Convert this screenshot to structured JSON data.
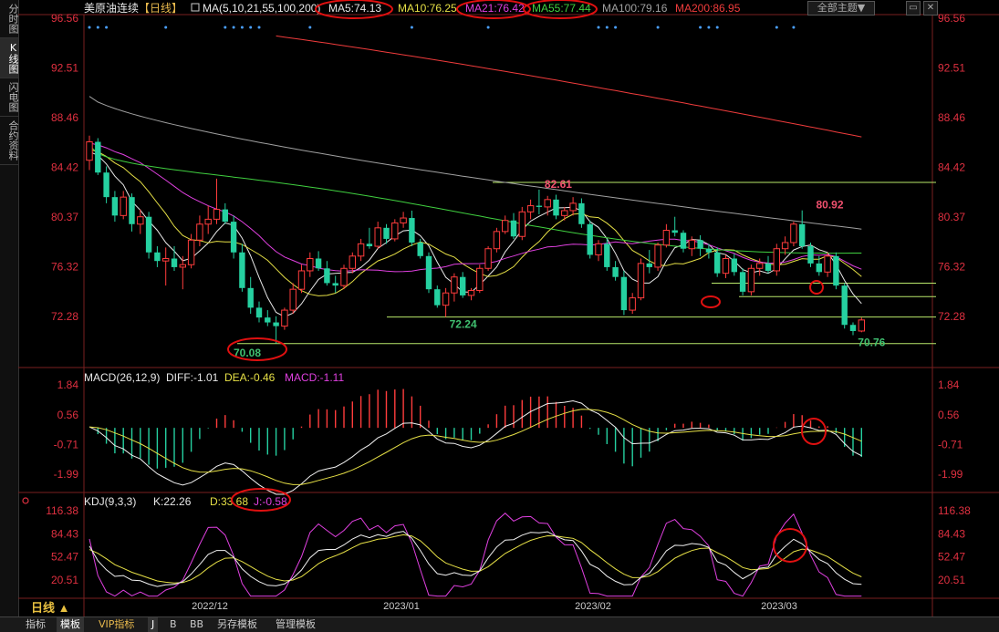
{
  "sidebar": {
    "tabs": [
      {
        "label": "分时图",
        "active": false
      },
      {
        "label": "K线图",
        "active": true
      },
      {
        "label": "闪电图",
        "active": false
      },
      {
        "label": "合约资料",
        "active": false
      }
    ]
  },
  "header": {
    "symbol": "美原油连续",
    "period_tag": "【日线】",
    "ma_params": "MA(5,10,21,55,100,200)",
    "ma_values": [
      {
        "label": "MA5:74.13",
        "color": "#e8e8e8"
      },
      {
        "label": "MA10:76.25",
        "color": "#e6e046"
      },
      {
        "label": "MA21:76.42",
        "color": "#e040e0"
      },
      {
        "label": "MA55:77.44",
        "color": "#40d040"
      },
      {
        "label": "MA100:79.16",
        "color": "#a0a0a0"
      },
      {
        "label": "MA200:86.95",
        "color": "#f03c3c"
      }
    ],
    "theme_button": "全部主题▼",
    "min_icon": "minimize-icon",
    "close_icon": "close-icon"
  },
  "price_axis": {
    "ticks": [
      "96.56",
      "92.51",
      "88.46",
      "84.42",
      "80.37",
      "76.32",
      "72.28"
    ]
  },
  "price_annotations": [
    {
      "text": "82.61",
      "color": "#f0506e"
    },
    {
      "text": "80.92",
      "color": "#f0506e"
    },
    {
      "text": "72.24",
      "color": "#40c070"
    },
    {
      "text": "70.08",
      "color": "#40c070"
    },
    {
      "text": "70.76",
      "color": "#40c070"
    }
  ],
  "macd": {
    "title": "MACD(26,12,9)",
    "diff": "DIFF:-1.01",
    "dea": "DEA:-0.46",
    "macd": "MACD:-1.11",
    "ticks": [
      "1.84",
      "0.56",
      "-0.71",
      "-1.99"
    ]
  },
  "kdj": {
    "title": "KDJ(9,3,3)",
    "k": "K:22.26",
    "d": "D:33.68",
    "j": "J:-0.58",
    "ticks": [
      "116.38",
      "84.43",
      "52.47",
      "20.51"
    ]
  },
  "period_button": "日线",
  "date_axis": [
    "2022/12",
    "2023/01",
    "2023/02",
    "2023/03"
  ],
  "bottom_tabs": [
    "指标",
    "模板",
    "VIP指标",
    "J",
    "B",
    "BB",
    "另存模板",
    "管理模板"
  ],
  "chart_data": [
    {
      "type": "candlestick",
      "name": "美原油连续 日线",
      "ylim": [
        68.5,
        96.56
      ],
      "ohlc": [
        [
          85.0,
          87.0,
          84.2,
          86.5
        ],
        [
          86.5,
          86.8,
          83.8,
          84.0
        ],
        [
          84.0,
          84.5,
          81.5,
          82.0
        ],
        [
          82.0,
          82.5,
          80.0,
          80.5
        ],
        [
          80.5,
          82.5,
          80.2,
          82.0
        ],
        [
          82.0,
          82.3,
          79.2,
          79.8
        ],
        [
          79.8,
          81.0,
          79.0,
          80.4
        ],
        [
          80.4,
          80.8,
          77.0,
          77.5
        ],
        [
          77.5,
          78.0,
          76.3,
          76.8
        ],
        [
          76.8,
          77.9,
          74.8,
          77.0
        ],
        [
          77.0,
          78.0,
          76.0,
          76.3
        ],
        [
          76.3,
          77.2,
          74.5,
          76.5
        ],
        [
          76.5,
          79.0,
          76.2,
          78.5
        ],
        [
          78.5,
          80.5,
          78.0,
          79.8
        ],
        [
          79.8,
          81.3,
          79.0,
          80.2
        ],
        [
          80.2,
          83.5,
          79.8,
          81.0
        ],
        [
          81.0,
          81.5,
          79.8,
          80.0
        ],
        [
          80.0,
          80.5,
          77.0,
          77.5
        ],
        [
          77.5,
          78.2,
          74.3,
          74.6
        ],
        [
          74.6,
          75.5,
          72.5,
          73.0
        ],
        [
          73.0,
          73.5,
          71.8,
          72.2
        ],
        [
          72.2,
          72.8,
          71.5,
          71.8
        ],
        [
          71.8,
          72.3,
          70.08,
          71.5
        ],
        [
          71.5,
          73.0,
          71.2,
          72.8
        ],
        [
          72.8,
          75.0,
          72.5,
          74.5
        ],
        [
          74.5,
          76.5,
          74.2,
          76.0
        ],
        [
          76.0,
          77.5,
          75.5,
          77.0
        ],
        [
          77.0,
          77.6,
          76.0,
          76.2
        ],
        [
          76.2,
          76.8,
          74.8,
          75.0
        ],
        [
          75.0,
          75.6,
          74.2,
          74.8
        ],
        [
          74.8,
          76.5,
          74.5,
          76.2
        ],
        [
          76.2,
          77.5,
          75.8,
          77.2
        ],
        [
          77.2,
          78.6,
          76.8,
          78.2
        ],
        [
          78.2,
          79.5,
          77.8,
          78.0
        ],
        [
          78.0,
          80.0,
          77.8,
          79.5
        ],
        [
          79.5,
          79.8,
          78.2,
          78.6
        ],
        [
          78.6,
          80.2,
          78.4,
          79.9
        ],
        [
          79.9,
          80.8,
          79.5,
          80.3
        ],
        [
          80.3,
          80.9,
          78.0,
          78.3
        ],
        [
          78.3,
          78.6,
          77.0,
          77.2
        ],
        [
          77.2,
          77.5,
          74.2,
          74.5
        ],
        [
          74.5,
          74.8,
          73.0,
          73.2
        ],
        [
          73.2,
          74.6,
          72.24,
          74.2
        ],
        [
          74.2,
          75.8,
          73.5,
          75.5
        ],
        [
          75.5,
          75.9,
          73.8,
          74.0
        ],
        [
          74.0,
          74.6,
          73.6,
          74.4
        ],
        [
          74.4,
          76.5,
          74.2,
          76.2
        ],
        [
          76.2,
          78.0,
          76.0,
          77.8
        ],
        [
          77.8,
          79.5,
          77.5,
          79.2
        ],
        [
          79.2,
          80.5,
          79.0,
          80.1
        ],
        [
          80.1,
          80.7,
          78.6,
          78.8
        ],
        [
          78.8,
          81.2,
          78.5,
          80.8
        ],
        [
          80.8,
          81.8,
          80.2,
          81.3
        ],
        [
          81.3,
          82.61,
          80.6,
          81.2
        ],
        [
          81.2,
          82.1,
          80.5,
          81.8
        ],
        [
          81.8,
          82.2,
          80.2,
          80.5
        ],
        [
          80.5,
          81.2,
          80.1,
          80.9
        ],
        [
          80.9,
          82.0,
          80.5,
          81.5
        ],
        [
          81.5,
          81.9,
          79.5,
          79.8
        ],
        [
          79.8,
          80.1,
          77.0,
          77.3
        ],
        [
          77.3,
          78.5,
          76.8,
          78.2
        ],
        [
          78.2,
          78.6,
          76.0,
          76.3
        ],
        [
          76.3,
          76.8,
          75.2,
          75.5
        ],
        [
          75.5,
          76.0,
          72.4,
          72.8
        ],
        [
          72.8,
          74.2,
          72.5,
          73.8
        ],
        [
          73.8,
          77.0,
          73.6,
          76.6
        ],
        [
          76.6,
          77.7,
          75.8,
          76.3
        ],
        [
          76.3,
          78.3,
          76.0,
          78.1
        ],
        [
          78.1,
          79.8,
          77.9,
          79.3
        ],
        [
          79.3,
          80.4,
          78.8,
          79.1
        ],
        [
          79.1,
          79.3,
          77.5,
          77.8
        ],
        [
          77.8,
          78.8,
          77.2,
          78.5
        ],
        [
          78.5,
          78.9,
          77.2,
          77.8
        ],
        [
          77.8,
          78.2,
          77.0,
          77.5
        ],
        [
          77.5,
          77.9,
          75.5,
          75.8
        ],
        [
          75.8,
          77.3,
          75.4,
          77.0
        ],
        [
          77.0,
          77.4,
          75.6,
          75.9
        ],
        [
          75.9,
          76.2,
          74.0,
          74.3
        ],
        [
          74.3,
          76.5,
          74.0,
          76.2
        ],
        [
          76.2,
          77.0,
          75.6,
          76.6
        ],
        [
          76.6,
          77.2,
          75.8,
          76.0
        ],
        [
          76.0,
          78.2,
          75.6,
          77.8
        ],
        [
          77.8,
          78.8,
          77.3,
          78.3
        ],
        [
          78.3,
          80.0,
          78.0,
          79.8
        ],
        [
          79.8,
          80.92,
          77.8,
          78.0
        ],
        [
          78.0,
          78.3,
          76.3,
          76.6
        ],
        [
          76.6,
          77.2,
          75.6,
          75.9
        ],
        [
          75.9,
          77.5,
          75.5,
          77.2
        ],
        [
          77.2,
          77.5,
          74.5,
          74.8
        ],
        [
          74.8,
          75.0,
          71.3,
          71.6
        ],
        [
          71.6,
          71.8,
          70.76,
          71.1
        ],
        [
          71.1,
          72.2,
          71.0,
          72.0
        ]
      ],
      "moving_averages": [
        {
          "name": "MA5",
          "color": "#e8e8e8",
          "last": 74.13
        },
        {
          "name": "MA10",
          "color": "#e6e046",
          "last": 76.25
        },
        {
          "name": "MA21",
          "color": "#e040e0",
          "last": 76.42
        },
        {
          "name": "MA55",
          "color": "#40d040",
          "last": 77.44
        },
        {
          "name": "MA100",
          "color": "#a0a0a0",
          "last": 79.16
        },
        {
          "name": "MA200",
          "color": "#f03c3c",
          "last": 86.95
        }
      ],
      "horizontal_lines": [
        83.2,
        75.0,
        73.9,
        72.24,
        70.08
      ]
    },
    {
      "type": "bar",
      "name": "MACD(26,12,9)",
      "ylim": [
        -2.3,
        2.0
      ],
      "last": {
        "DIFF": -1.01,
        "DEA": -0.46,
        "MACD": -1.11
      }
    },
    {
      "type": "line",
      "name": "KDJ(9,3,3)",
      "ylim": [
        0,
        116.38
      ],
      "last": {
        "K": 22.26,
        "D": 33.68,
        "J": -0.58
      }
    }
  ]
}
